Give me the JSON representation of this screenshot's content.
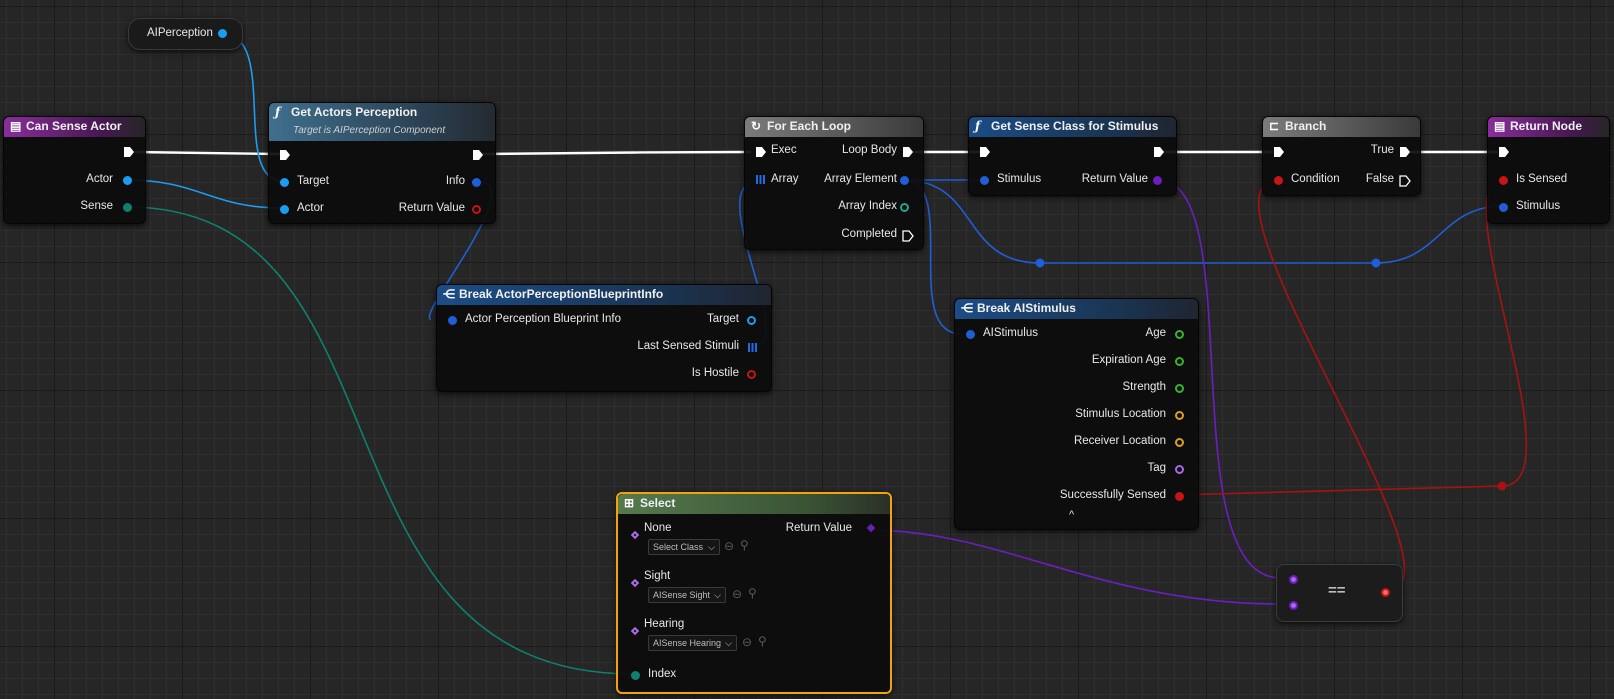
{
  "nodes": {
    "aiperception": {
      "label": "AIPerception"
    },
    "can_sense_actor": {
      "title": "Can Sense Actor",
      "pins": {
        "actor": "Actor",
        "sense": "Sense"
      }
    },
    "get_actors_perception": {
      "title": "Get Actors Perception",
      "subtitle": "Target is AIPerception Component",
      "pins": {
        "target": "Target",
        "actor": "Actor",
        "info": "Info",
        "return_value": "Return Value"
      }
    },
    "break_perception_info": {
      "title": "Break ActorPerceptionBlueprintInfo",
      "pins": {
        "input": "Actor Perception Blueprint Info",
        "target": "Target",
        "last_sensed_stimuli": "Last Sensed Stimuli",
        "is_hostile": "Is Hostile"
      }
    },
    "for_each_loop": {
      "title": "For Each Loop",
      "pins": {
        "exec": "Exec",
        "array": "Array",
        "loop_body": "Loop Body",
        "array_element": "Array Element",
        "array_index": "Array Index",
        "completed": "Completed"
      }
    },
    "get_sense_class": {
      "title": "Get Sense Class for Stimulus",
      "pins": {
        "stimulus": "Stimulus",
        "return_value": "Return Value"
      }
    },
    "break_aistimulus": {
      "title": "Break AIStimulus",
      "pins": {
        "input": "AIStimulus",
        "age": "Age",
        "expiration_age": "Expiration Age",
        "strength": "Strength",
        "stimulus_location": "Stimulus Location",
        "receiver_location": "Receiver Location",
        "tag": "Tag",
        "successfully_sensed": "Successfully Sensed"
      },
      "collapse_icon": "chevron-up-icon"
    },
    "branch": {
      "title": "Branch",
      "pins": {
        "condition": "Condition",
        "true": "True",
        "false": "False"
      }
    },
    "return_node": {
      "title": "Return Node",
      "pins": {
        "is_sensed": "Is Sensed",
        "stimulus": "Stimulus"
      }
    },
    "select": {
      "title": "Select",
      "options": [
        {
          "label": "None",
          "value": "Select Class"
        },
        {
          "label": "Sight",
          "value": "AISense Sight"
        },
        {
          "label": "Hearing",
          "value": "AISense Hearing"
        }
      ],
      "return_value": "Return Value",
      "index": "Index"
    },
    "equals": {
      "label": "=="
    }
  },
  "colors": {
    "exec": "#ffffff",
    "object": "#1b9cf0",
    "struct": "#1f5fd6",
    "class": "#6b1fbf",
    "bool": "#c71414",
    "byte": "#0e8070",
    "float": "#36b52c",
    "vector": "#d8a21b",
    "name": "#a868e8",
    "selection": "#f2a20b"
  }
}
